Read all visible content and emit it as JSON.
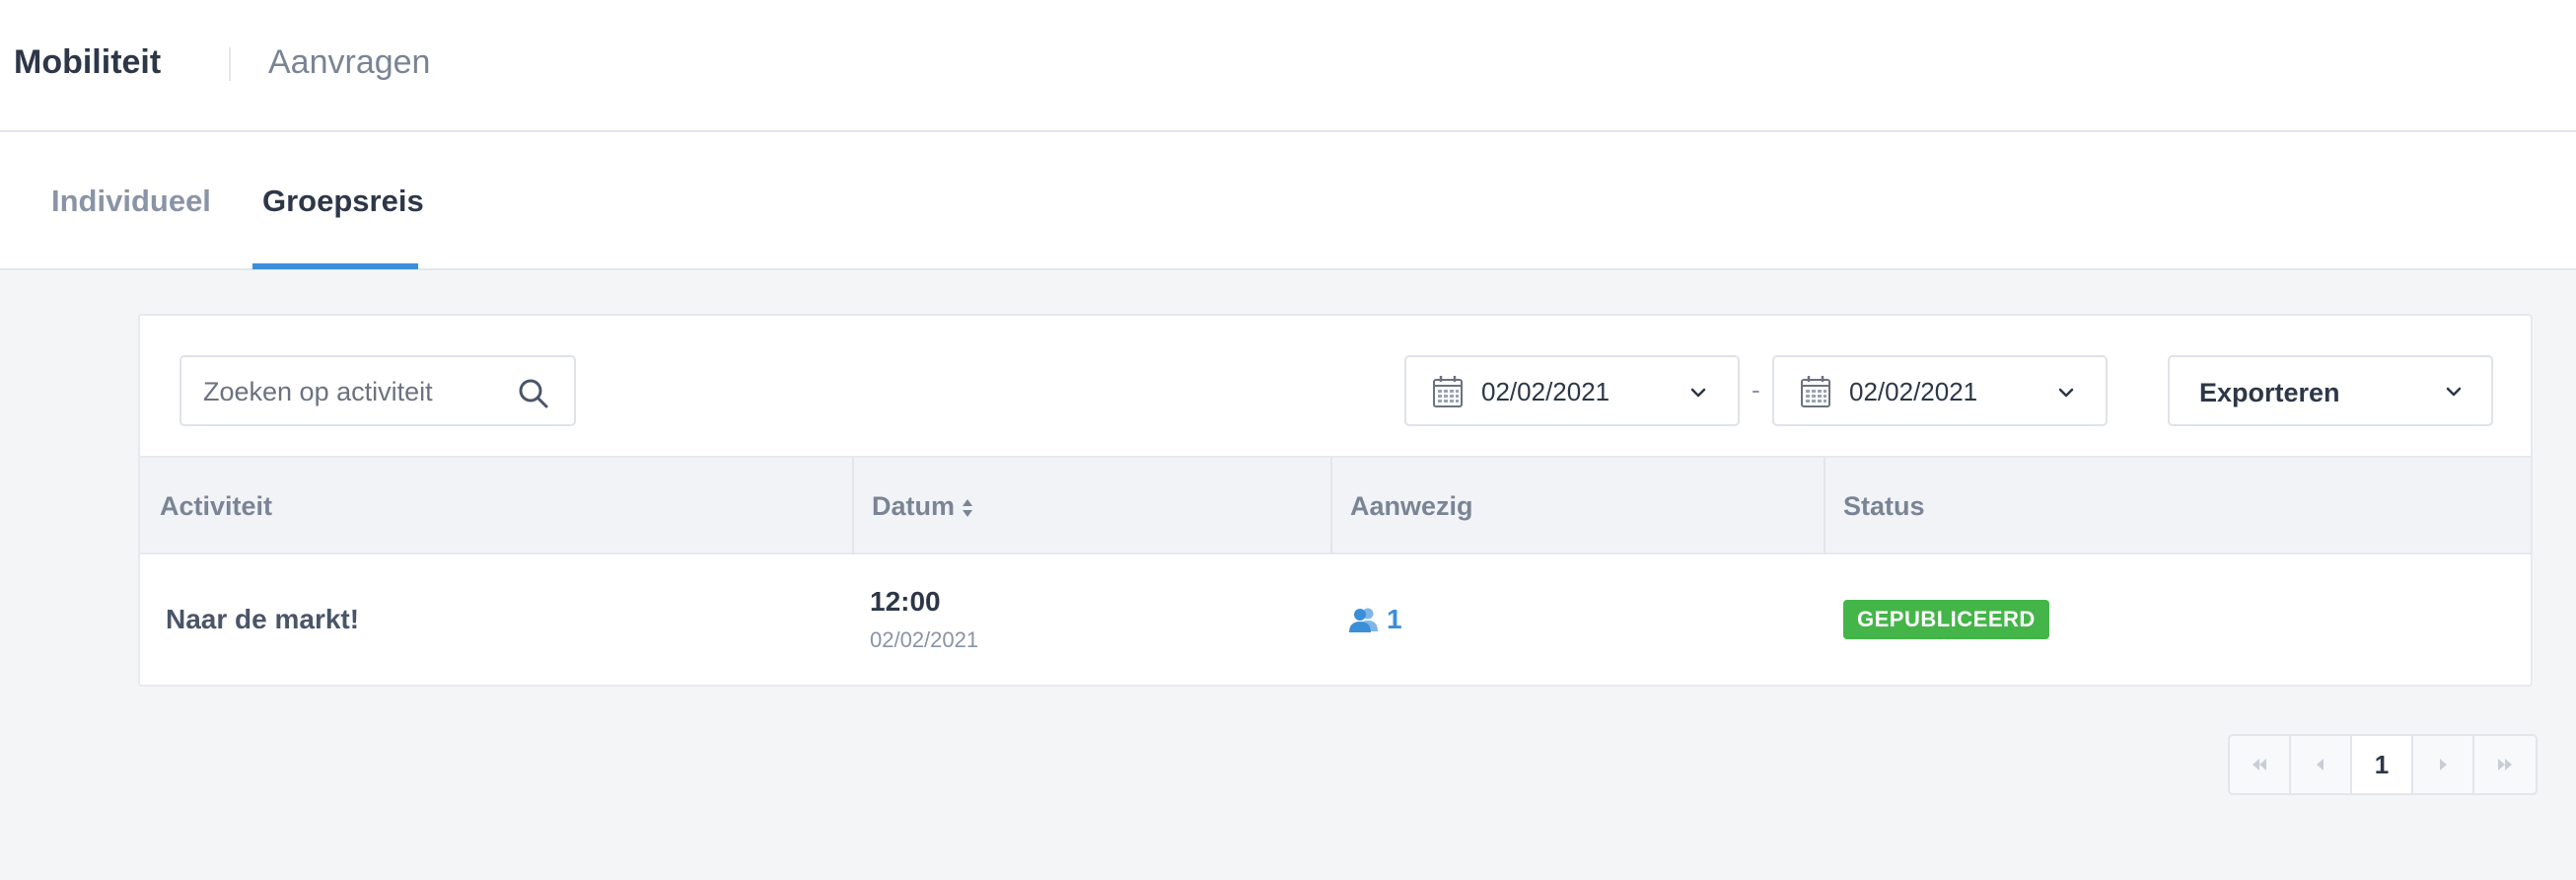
{
  "header": {
    "app_title": "Mobiliteit",
    "nav_link": "Aanvragen"
  },
  "tabs": [
    {
      "label": "Individueel",
      "active": false
    },
    {
      "label": "Groepsreis",
      "active": true
    }
  ],
  "toolbar": {
    "search_placeholder": "Zoeken op activiteit",
    "search_value": "",
    "date_from": "02/02/2021",
    "date_separator": "-",
    "date_to": "02/02/2021",
    "export_label": "Exporteren"
  },
  "table": {
    "columns": [
      "Activiteit",
      "Datum",
      "Aanwezig",
      "Status"
    ],
    "rows": [
      {
        "activity": "Naar de markt!",
        "time": "12:00",
        "date": "02/02/2021",
        "present": "1",
        "status": "GEPUBLICEERD"
      }
    ]
  },
  "pagination": {
    "current_page": "1"
  },
  "colors": {
    "accent": "#3b8fd9",
    "status_published": "#44b548",
    "background": "#f4f5f7"
  }
}
